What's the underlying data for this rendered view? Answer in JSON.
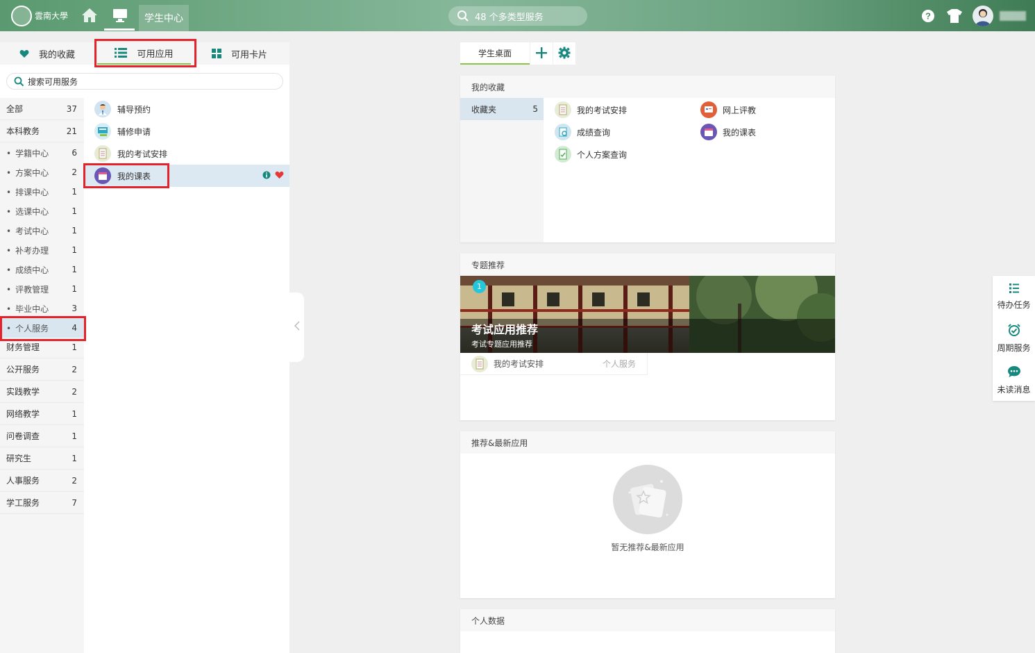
{
  "header": {
    "logo_text": "雲南大學",
    "active_tab": "学生中心",
    "search_text": "48 个多类型服务",
    "username_redacted": ""
  },
  "left_panel": {
    "tabs": [
      {
        "label": "我的收藏",
        "icon": "heart-icon"
      },
      {
        "label": "可用应用",
        "icon": "list-icon"
      },
      {
        "label": "可用卡片",
        "icon": "grid-icon"
      }
    ],
    "search_placeholder": "搜索可用服务",
    "categories": [
      {
        "label": "全部",
        "count": "37",
        "type": "main"
      },
      {
        "label": "本科教务",
        "count": "21",
        "type": "main"
      },
      {
        "label": "学籍中心",
        "count": "6",
        "type": "sub"
      },
      {
        "label": "方案中心",
        "count": "2",
        "type": "sub"
      },
      {
        "label": "排课中心",
        "count": "1",
        "type": "sub"
      },
      {
        "label": "选课中心",
        "count": "1",
        "type": "sub"
      },
      {
        "label": "考试中心",
        "count": "1",
        "type": "sub"
      },
      {
        "label": "补考办理",
        "count": "1",
        "type": "sub"
      },
      {
        "label": "成绩中心",
        "count": "1",
        "type": "sub"
      },
      {
        "label": "评教管理",
        "count": "1",
        "type": "sub"
      },
      {
        "label": "毕业中心",
        "count": "3",
        "type": "sub"
      },
      {
        "label": "个人服务",
        "count": "4",
        "type": "sub",
        "active": true
      },
      {
        "label": "财务管理",
        "count": "1",
        "type": "main"
      },
      {
        "label": "公开服务",
        "count": "2",
        "type": "main"
      },
      {
        "label": "实践教学",
        "count": "2",
        "type": "main"
      },
      {
        "label": "网络教学",
        "count": "1",
        "type": "main"
      },
      {
        "label": "问卷调查",
        "count": "1",
        "type": "main"
      },
      {
        "label": "研究生",
        "count": "1",
        "type": "main"
      },
      {
        "label": "人事服务",
        "count": "2",
        "type": "main"
      },
      {
        "label": "学工服务",
        "count": "7",
        "type": "main"
      }
    ],
    "apps": [
      {
        "label": "辅导预约",
        "icon": "tutor-icon"
      },
      {
        "label": "辅修申请",
        "icon": "minor-apply-icon"
      },
      {
        "label": "我的考试安排",
        "icon": "exam-schedule-icon"
      },
      {
        "label": "我的课表",
        "icon": "timetable-icon",
        "active": true
      }
    ]
  },
  "desk": {
    "tab_label": "学生桌面",
    "favorites": {
      "title": "我的收藏",
      "folder_label": "收藏夹",
      "folder_count": "5",
      "apps": [
        {
          "label": "我的考试安排",
          "icon": "exam-schedule-icon"
        },
        {
          "label": "网上评教",
          "icon": "evaluation-icon"
        },
        {
          "label": "成绩查询",
          "icon": "grade-query-icon"
        },
        {
          "label": "我的课表",
          "icon": "timetable-icon"
        },
        {
          "label": "个人方案查询",
          "icon": "plan-query-icon"
        }
      ]
    },
    "topics": {
      "title": "专题推荐",
      "banner_number": "1",
      "banner_title": "考试应用推荐",
      "banner_subtitle": "考试专题应用推荐",
      "item_label": "我的考试安排",
      "item_category": "个人服务"
    },
    "recommend": {
      "title": "推荐&最新应用",
      "empty_text": "暂无推荐&最新应用"
    },
    "personal": {
      "title": "个人数据"
    }
  },
  "side_float": [
    {
      "label": "待办任务",
      "icon": "todo-list-icon"
    },
    {
      "label": "周期服务",
      "icon": "alarm-clock-icon"
    },
    {
      "label": "未读消息",
      "icon": "chat-bubble-icon"
    }
  ],
  "colors": {
    "accent_green": "#8bc34a",
    "highlight_red": "#e5212a",
    "active_row": "#d9e6ef",
    "teal_icon": "#16887e"
  }
}
